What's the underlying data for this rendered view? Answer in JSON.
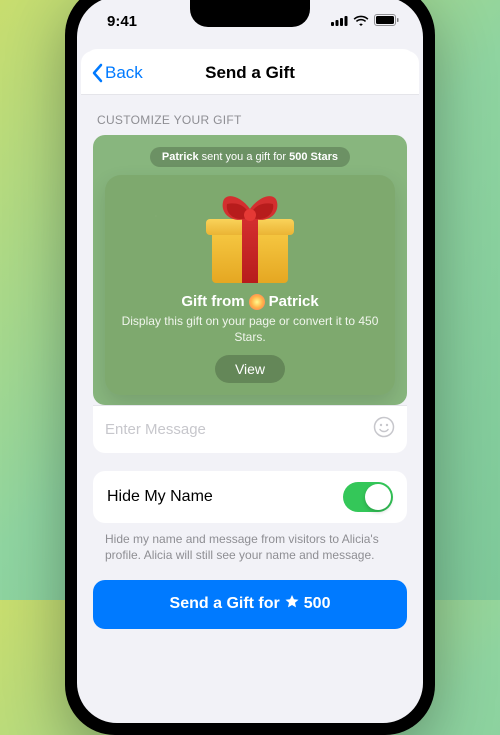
{
  "status": {
    "time": "9:41"
  },
  "nav": {
    "back": "Back",
    "title": "Send a Gift"
  },
  "section_header": "Customize Your Gift",
  "preview": {
    "banner_sender": "Patrick",
    "banner_mid": " sent you a gift for ",
    "banner_cost": "500 Stars",
    "title_prefix": "Gift from",
    "title_name": "Patrick",
    "description": "Display this gift on your page or convert it to 450 Stars.",
    "view_label": "View"
  },
  "message": {
    "placeholder": "Enter Message",
    "value": ""
  },
  "hide": {
    "label": "Hide My Name",
    "on": true,
    "hint": "Hide my name and message from visitors to Alicia's profile. Alicia will still see your name and message."
  },
  "cta": {
    "prefix": "Send a Gift for",
    "amount": "500"
  },
  "colors": {
    "accent": "#007aff",
    "toggle_on": "#34c759"
  }
}
